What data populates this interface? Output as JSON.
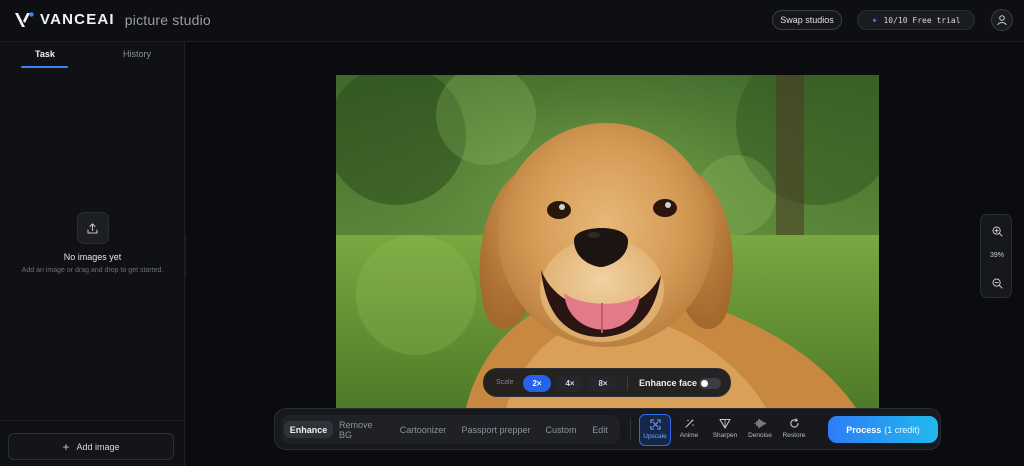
{
  "header": {
    "brand": "VANCEAI",
    "product": "picture studio",
    "swap_label": "Swap studios",
    "trial_label": "10/10 Free trial",
    "logo_icon": "vanceai-v-logo",
    "avatar_icon": "user-icon"
  },
  "sidebar": {
    "tabs": [
      {
        "label": "Task",
        "active": true
      },
      {
        "label": "History",
        "active": false
      }
    ],
    "empty_title": "No images yet",
    "empty_subtitle": "Add an image or drag and drop to get started.",
    "empty_icon": "upload-icon",
    "add_label": "Add image"
  },
  "canvas": {
    "photo_subject": "golden-retriever-photo",
    "zoom_level": "39%"
  },
  "scale_bar": {
    "label": "Scale",
    "options": [
      "2×",
      "4×",
      "8×"
    ],
    "selected": "2×",
    "enhance_face_label": "Enhance face",
    "enhance_face_on": false
  },
  "toolbar": {
    "modes": [
      "Enhance",
      "Remove BG",
      "Cartoonizer",
      "Passport prepper",
      "Custom",
      "Edit"
    ],
    "selected_mode": "Enhance",
    "tools": [
      {
        "label": "Upscale",
        "icon": "upscale-icon",
        "selected": true
      },
      {
        "label": "Anime",
        "icon": "wand-icon",
        "selected": false
      },
      {
        "label": "Sharpen",
        "icon": "sharpen-icon",
        "selected": false
      },
      {
        "label": "Denoise",
        "icon": "denoise-icon",
        "selected": false
      },
      {
        "label": "Restore",
        "icon": "restore-icon",
        "selected": false
      }
    ],
    "process_label": "Process",
    "process_credit": "(1 credit)"
  },
  "colors": {
    "accent": "#2563eb",
    "background": "#0e0f12",
    "process_gradient_start": "#2d7df6",
    "process_gradient_end": "#22b8ee"
  }
}
